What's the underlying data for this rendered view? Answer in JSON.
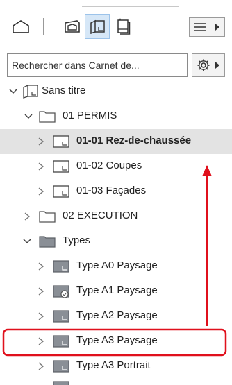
{
  "search": {
    "placeholder": "Rechercher dans Carnet de..."
  },
  "tree": {
    "root": {
      "label": "Sans titre"
    },
    "folder_permis": {
      "label": "01 PERMIS"
    },
    "item_rdc": {
      "label": "01-01 Rez-de-chaussée"
    },
    "item_coupes": {
      "label": "01-02 Coupes"
    },
    "item_facades": {
      "label": "01-03 Façades"
    },
    "folder_execution": {
      "label": "02 EXECUTION"
    },
    "folder_types": {
      "label": "Types"
    },
    "type_a0": {
      "label": "Type A0 Paysage"
    },
    "type_a1": {
      "label": "Type A1 Paysage"
    },
    "type_a2": {
      "label": "Type A2 Paysage"
    },
    "type_a3": {
      "label": "Type A3 Paysage"
    },
    "type_a3p": {
      "label": "Type A3 Portrait"
    }
  },
  "colors": {
    "accent_red": "#e0101c",
    "selected_bg": "#e3e3e3",
    "active_tool_bg": "#d6e7f7"
  }
}
